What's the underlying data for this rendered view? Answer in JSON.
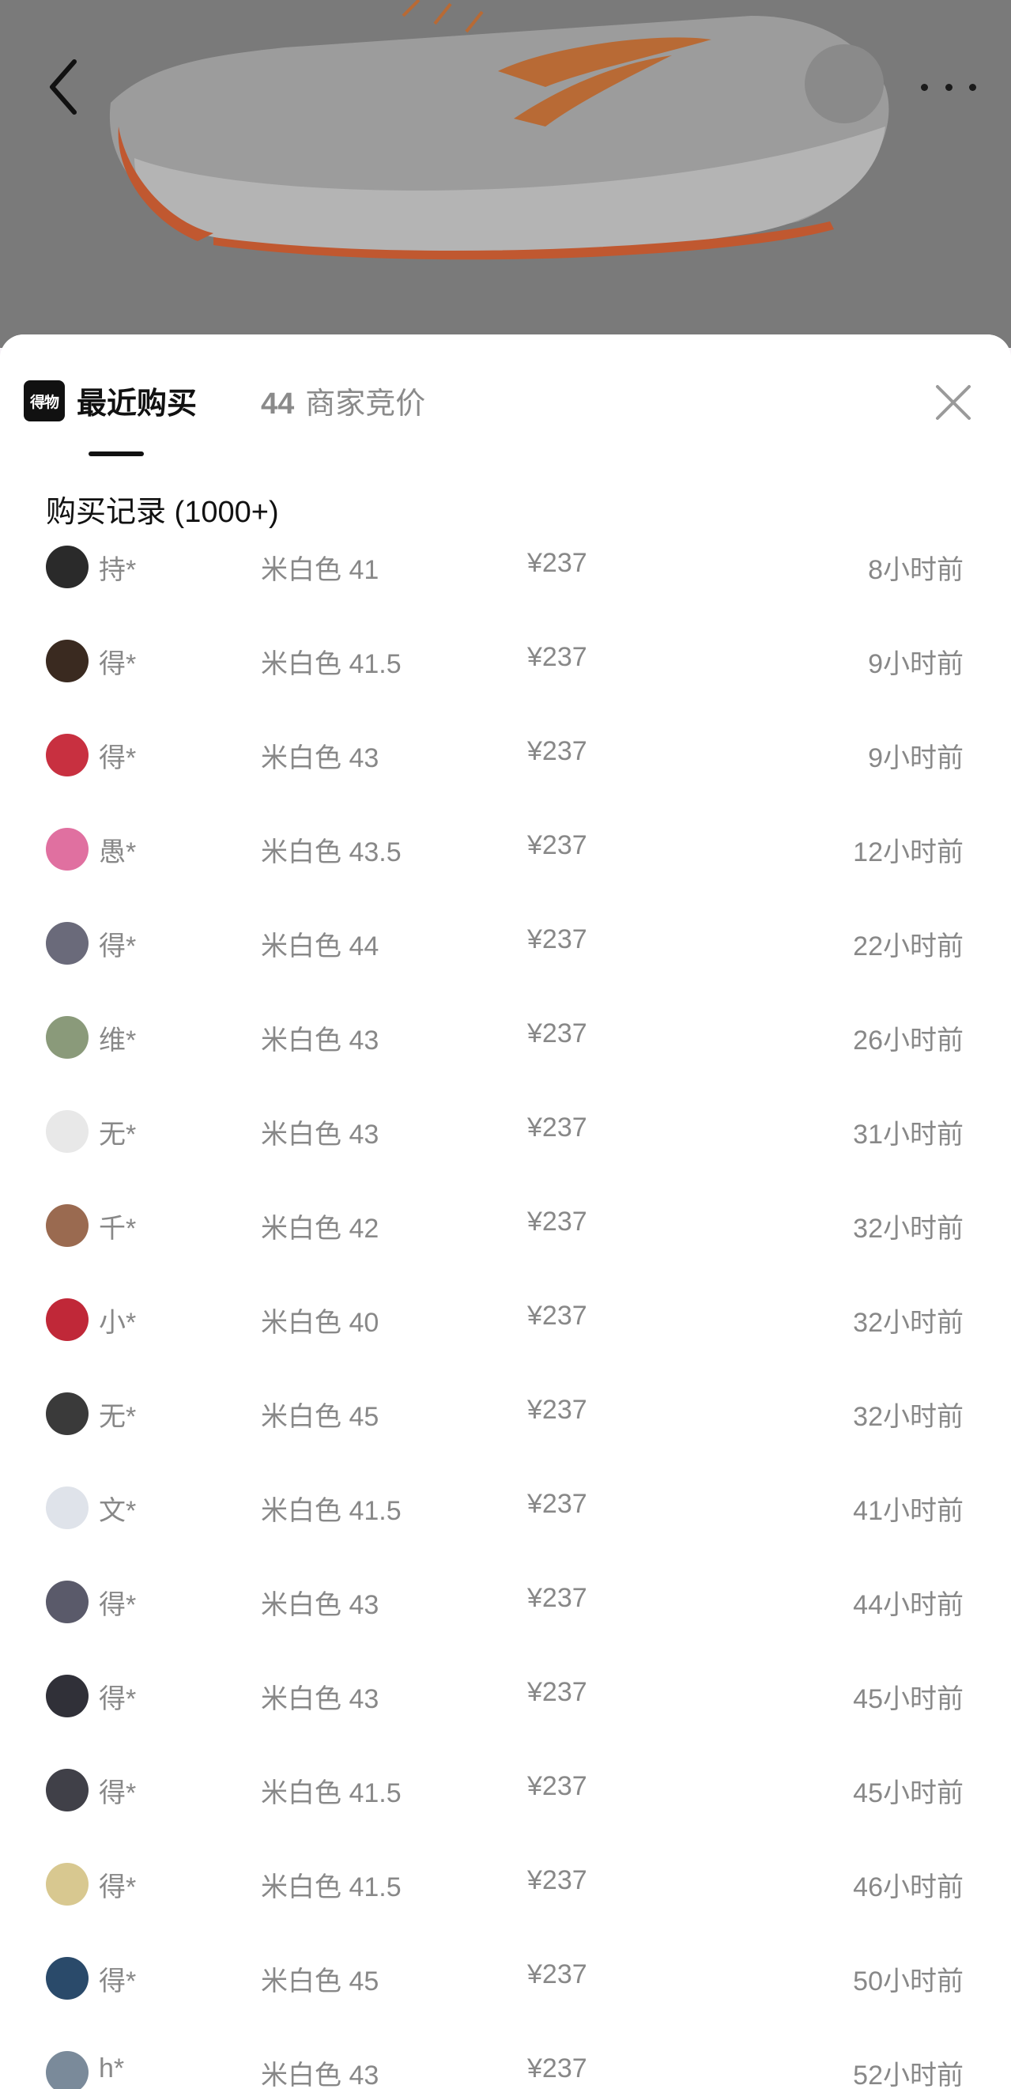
{
  "tabs": {
    "logo_text": "得物",
    "recent": "最近购买",
    "bid_count": "44",
    "bid_label": "商家竞价"
  },
  "section": {
    "title": "购买记录 (1000+)"
  },
  "records": [
    {
      "user": "持*",
      "spec": "米白色 41",
      "price": "¥237",
      "time": "8小时前",
      "avatar_color": "#2a2a2a"
    },
    {
      "user": "得*",
      "spec": "米白色 41.5",
      "price": "¥237",
      "time": "9小时前",
      "avatar_color": "#3a2a20"
    },
    {
      "user": "得*",
      "spec": "米白色 43",
      "price": "¥237",
      "time": "9小时前",
      "avatar_color": "#c83040"
    },
    {
      "user": "愚*",
      "spec": "米白色 43.5",
      "price": "¥237",
      "time": "12小时前",
      "avatar_color": "#e070a0"
    },
    {
      "user": "得*",
      "spec": "米白色 44",
      "price": "¥237",
      "time": "22小时前",
      "avatar_color": "#6a6a7a"
    },
    {
      "user": "维*",
      "spec": "米白色 43",
      "price": "¥237",
      "time": "26小时前",
      "avatar_color": "#8a9a7a"
    },
    {
      "user": "无*",
      "spec": "米白色 43",
      "price": "¥237",
      "time": "31小时前",
      "avatar_color": "#e8e8e8"
    },
    {
      "user": "千*",
      "spec": "米白色 42",
      "price": "¥237",
      "time": "32小时前",
      "avatar_color": "#9a6a50"
    },
    {
      "user": "小*",
      "spec": "米白色 40",
      "price": "¥237",
      "time": "32小时前",
      "avatar_color": "#c02838"
    },
    {
      "user": "无*",
      "spec": "米白色 45",
      "price": "¥237",
      "time": "32小时前",
      "avatar_color": "#3a3a3a"
    },
    {
      "user": "文*",
      "spec": "米白色 41.5",
      "price": "¥237",
      "time": "41小时前",
      "avatar_color": "#dfe3ea"
    },
    {
      "user": "得*",
      "spec": "米白色 43",
      "price": "¥237",
      "time": "44小时前",
      "avatar_color": "#5a5a6a"
    },
    {
      "user": "得*",
      "spec": "米白色 43",
      "price": "¥237",
      "time": "45小时前",
      "avatar_color": "#303038"
    },
    {
      "user": "得*",
      "spec": "米白色 41.5",
      "price": "¥237",
      "time": "45小时前",
      "avatar_color": "#404048"
    },
    {
      "user": "得*",
      "spec": "米白色 41.5",
      "price": "¥237",
      "time": "46小时前",
      "avatar_color": "#d8c890"
    },
    {
      "user": "得*",
      "spec": "米白色 45",
      "price": "¥237",
      "time": "50小时前",
      "avatar_color": "#2a4a6a"
    },
    {
      "user": "h*",
      "spec": "米白色 43",
      "price": "¥237",
      "time": "52小时前",
      "avatar_color": "#7a8a9a"
    }
  ],
  "icons": {
    "back": "chevron-left-icon",
    "more": "more-dots-icon",
    "close": "close-icon"
  }
}
